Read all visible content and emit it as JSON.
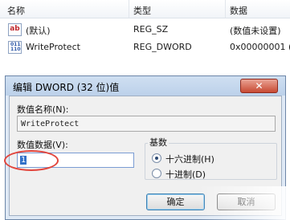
{
  "list": {
    "columns": {
      "name": "名称",
      "type": "类型",
      "data": "数据"
    },
    "rows": [
      {
        "icon": "string-value-icon",
        "icon_text": "ab",
        "name": "(默认)",
        "type": "REG_SZ",
        "data": "(数值未设置)"
      },
      {
        "icon": "binary-value-icon",
        "icon_text": "011 110",
        "name": "WriteProtect",
        "type": "REG_DWORD",
        "data": "0x00000001 ("
      }
    ]
  },
  "dialog": {
    "title": "编辑 DWORD (32 位)值",
    "close_icon": "✕",
    "value_name_label": "数值名称(N):",
    "value_name": "WriteProtect",
    "value_data_label": "数值数据(V):",
    "value_data": "1",
    "base_label": "基数",
    "hex_label": "十六进制(H)",
    "dec_label": "十进制(D)",
    "hex_selected": true,
    "ok_label": "确定",
    "cancel_label": "取消"
  }
}
